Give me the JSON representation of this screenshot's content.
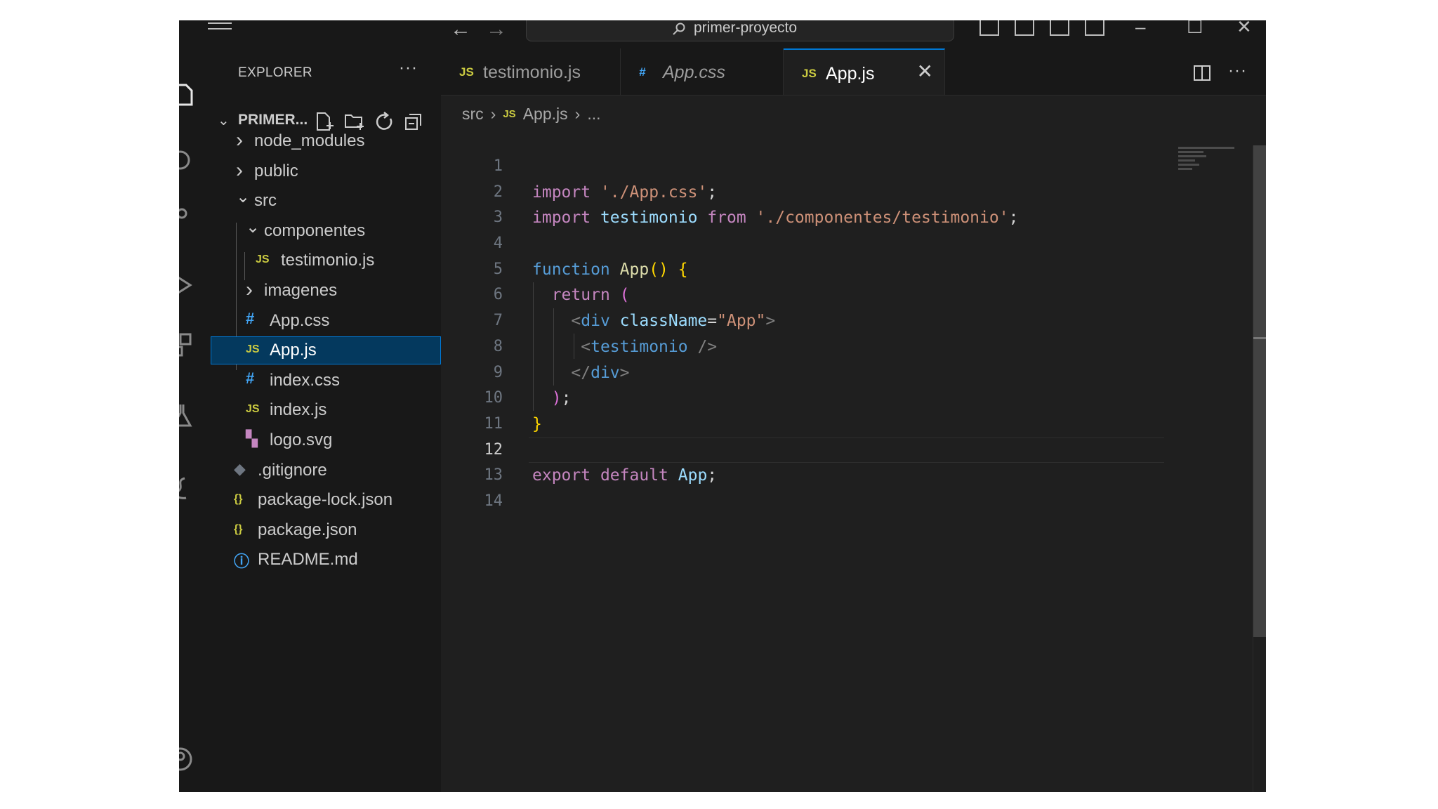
{
  "titlebar": {
    "title": "primer-proyecto"
  },
  "sidebar": {
    "header": "EXPLORER",
    "more": "···",
    "project": "PRIMER...",
    "tree": [
      {
        "label": "node_modules",
        "icon": "",
        "chev": "›",
        "depth": 0
      },
      {
        "label": "public",
        "icon": "",
        "chev": "›",
        "depth": 0
      },
      {
        "label": "src",
        "icon": "",
        "chev": "⌄",
        "depth": 0
      },
      {
        "label": "componentes",
        "icon": "",
        "chev": "⌄",
        "depth": 1
      },
      {
        "label": "testimonio.js",
        "icon": "JS",
        "chev": "",
        "depth": 2
      },
      {
        "label": "imagenes",
        "icon": "",
        "chev": "›",
        "depth": 1
      },
      {
        "label": "App.css",
        "icon": "#",
        "chev": "",
        "depth": 1
      },
      {
        "label": "App.js",
        "icon": "JS",
        "chev": "",
        "depth": 1
      },
      {
        "label": "index.css",
        "icon": "#",
        "chev": "",
        "depth": 1
      },
      {
        "label": "index.js",
        "icon": "JS",
        "chev": "",
        "depth": 1
      },
      {
        "label": "logo.svg",
        "icon": "▚",
        "chev": "",
        "depth": 1
      },
      {
        "label": ".gitignore",
        "icon": "◆",
        "chev": "",
        "depth": 0
      },
      {
        "label": "package-lock.json",
        "icon": "{}",
        "chev": "",
        "depth": 0
      },
      {
        "label": "package.json",
        "icon": "{}",
        "chev": "",
        "depth": 0
      },
      {
        "label": "README.md",
        "icon": "ⓘ",
        "chev": "",
        "depth": 0
      }
    ]
  },
  "editor": {
    "tabs": [
      {
        "label": "testimonio.js",
        "icon": "JS"
      },
      {
        "label": "App.css",
        "icon": "#"
      },
      {
        "label": "App.js",
        "icon": "JS"
      }
    ],
    "tab_close": "✕",
    "more": "···",
    "breadcrumb": {
      "folder": "src",
      "icon": "JS",
      "file": "App.js",
      "rest": "..."
    },
    "line_numbers": [
      "1",
      "2",
      "3",
      "4",
      "5",
      "6",
      "7",
      "8",
      "9",
      "10",
      "11",
      "12",
      "13",
      "14"
    ],
    "code": {
      "l2_import": "import",
      "l2_path": "'./App.css'",
      "l2_semi": ";",
      "l3_import": "import",
      "l3_name": "testimonio",
      "l3_from": "from",
      "l3_path": "'./componentes/testimonio'",
      "l3_semi": ";",
      "l5_function": "function",
      "l5_name": "App",
      "l5_parens": "()",
      "l5_brace": "{",
      "l6_return": "return",
      "l6_paren": "(",
      "l7_open": "<",
      "l7_tag": "div",
      "l7_attr": "className",
      "l7_eq": "=",
      "l7_val": "\"App\"",
      "l7_close": ">",
      "l8_open": "<",
      "l8_tag": "testimonio",
      "l8_close": " />",
      "l9_open": "</",
      "l9_tag": "div",
      "l9_close": ">",
      "l10_paren": ")",
      "l10_semi": ";",
      "l11_brace": "}",
      "l13_export": "export",
      "l13_default": "default",
      "l13_name": "App",
      "l13_semi": ";"
    }
  },
  "colors": {
    "js_icon": "#cbcb41",
    "css_icon": "#42a5f5",
    "json_icon": "#cbcb41",
    "svg_icon": "#c586c0",
    "readme_icon": "#42a5f5",
    "git_icon": "#6e7681",
    "accent": "#0078d4"
  }
}
